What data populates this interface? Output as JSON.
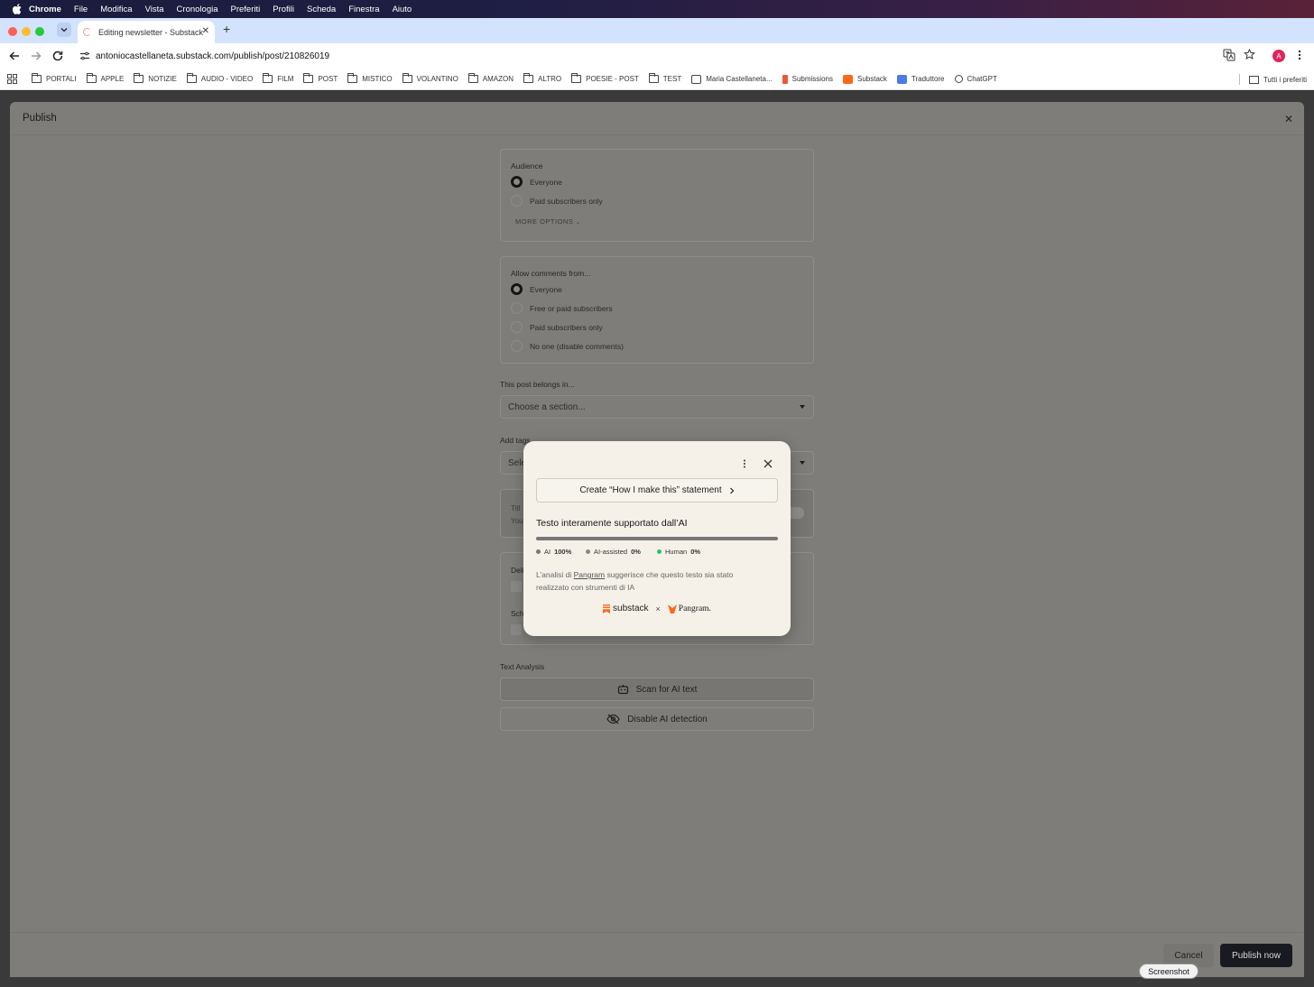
{
  "menubar": {
    "items": [
      "Chrome",
      "File",
      "Modifica",
      "Vista",
      "Cronologia",
      "Preferiti",
      "Profili",
      "Scheda",
      "Finestra",
      "Aiuto"
    ]
  },
  "browser": {
    "tab_title": "Editing newsletter - Substack",
    "url": "antoniocastellaneta.substack.com/publish/post/210826019",
    "profile_initial": "A",
    "bookmarks": [
      "PORTALI",
      "APPLE",
      "NOTIZIE",
      "AUDIO - VIDEO",
      "FILM",
      "POST",
      "MISTICO",
      "VOLANTINO",
      "AMAZON",
      "ALTRO",
      "POESIE - POST",
      "TEST",
      "Maria Castellaneta...",
      "Submissions",
      "Substack",
      "Traduttore",
      "ChatGPT"
    ],
    "all_bookmarks": "Tutti i preferiti"
  },
  "panel": {
    "title": "Publish",
    "audience": {
      "label": "Audience",
      "options": [
        "Everyone",
        "Paid subscribers only"
      ],
      "selected": "Everyone",
      "more_options": "MORE OPTIONS"
    },
    "comments": {
      "label": "Allow comments from...",
      "options": [
        "Everyone",
        "Free or paid subscribers",
        "Paid subscribers only",
        "No one (disable comments)"
      ],
      "selected": "Everyone"
    },
    "section": {
      "label": "This post belongs in...",
      "placeholder": "Choose a section..."
    },
    "tags": {
      "label": "Add tags",
      "placeholder": "Sele"
    },
    "partial_card_1": {
      "line1": "Titl",
      "line2": "You"
    },
    "partial_card_2": {
      "line1": "Deli",
      "line2": "Sch"
    },
    "text_analysis": {
      "label": "Text Analysis",
      "scan_label": "Scan for AI text",
      "disable_label": "Disable AI detection"
    },
    "footer": {
      "cancel": "Cancel",
      "publish": "Publish now"
    }
  },
  "popup": {
    "statement_button": "Create “How I make this” statement",
    "verdict": "Testo interamente supportato dall’AI",
    "legend": [
      {
        "name": "AI",
        "value": "100%",
        "color": "#777777"
      },
      {
        "name": "AI-assisted",
        "value": "0%",
        "color": "#888888"
      },
      {
        "name": "Human",
        "value": "0%",
        "color": "#2fbf71"
      }
    ],
    "explanation_pre": "L’analisi di ",
    "explanation_link": "Pangram",
    "explanation_post": " suggerisce che questo testo sia stato realizzato con strumenti di IA",
    "logo_substack": "substack",
    "logo_times": "×",
    "logo_pangram": "Pangram."
  },
  "tooltip": "Screenshot",
  "colors": {
    "accent_substack": "#ff6719",
    "publish_button": "#191a1f",
    "human_green": "#2fbf71"
  }
}
